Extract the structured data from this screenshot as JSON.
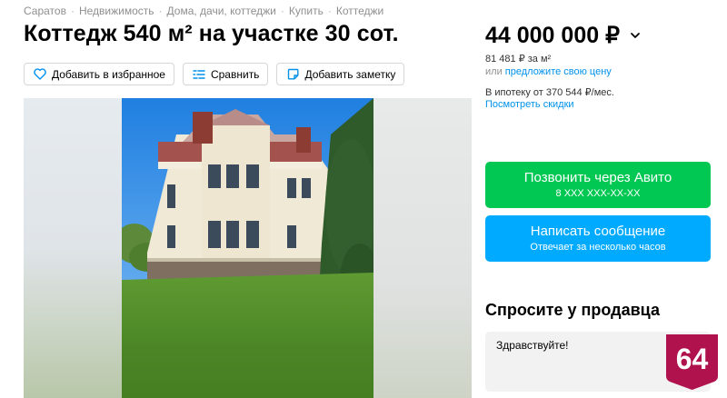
{
  "breadcrumb": [
    "Саратов",
    "Недвижимость",
    "Дома, дачи, коттеджи",
    "Купить",
    "Коттеджи"
  ],
  "breadcrumb_separator": "·",
  "title": "Коттедж 540 м² на участке 30 сот.",
  "actions": {
    "favorite": "Добавить в избранное",
    "compare": "Сравнить",
    "note": "Добавить заметку"
  },
  "price": {
    "value": "44 000 000 ₽",
    "per_m2": "81 481 ₽ за м²",
    "offer_prefix": "или",
    "offer_link": "предложите свою цену",
    "mortgage": "В ипотеку от 370 544 ₽/мес.",
    "discounts": "Посмотреть скидки"
  },
  "contact": {
    "call_label": "Позвонить через Авито",
    "call_phone": "8 XXX XXX-XX-XX",
    "message_label": "Написать сообщение",
    "message_sub": "Отвечает за несколько часов"
  },
  "ask": {
    "title": "Спросите у продавца",
    "message": "Здравствуйте!"
  },
  "badge": {
    "text": "64",
    "color": "#b0124e"
  },
  "colors": {
    "call": "#00c853",
    "message": "#00aaff",
    "link": "#0091ea"
  },
  "icons": {
    "favorite": "heart-icon",
    "compare": "compare-icon",
    "note": "note-icon",
    "price_toggle": "chevron-down-icon"
  }
}
